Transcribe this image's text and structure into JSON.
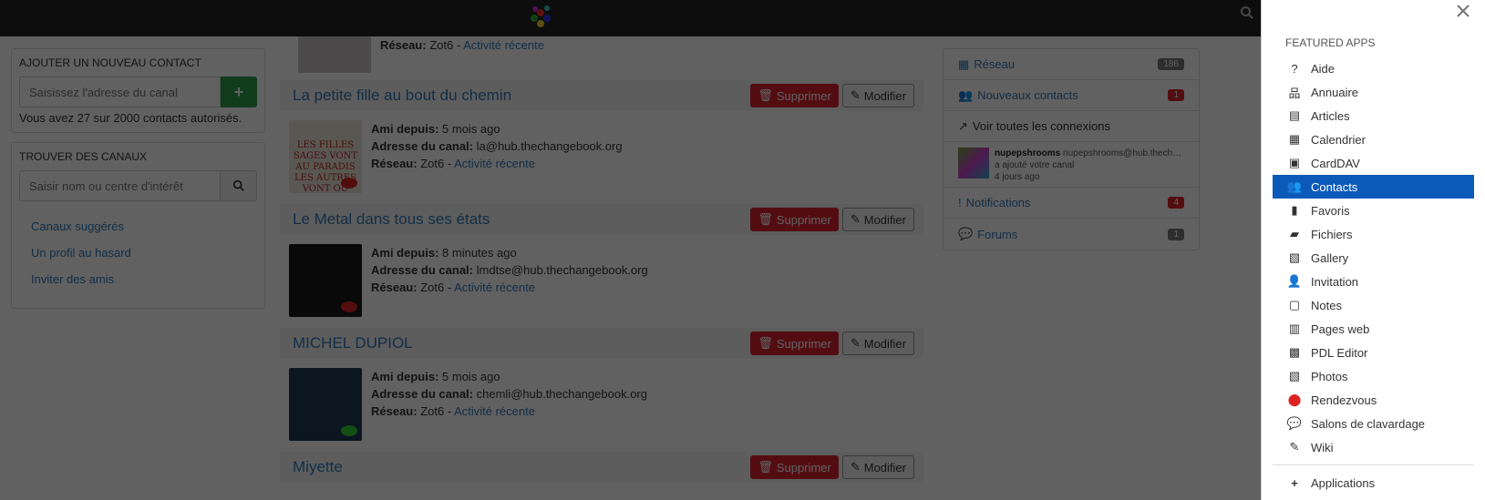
{
  "left": {
    "add_contact": {
      "title": "AJOUTER UN NOUVEAU CONTACT",
      "placeholder": "Saisissez l'adresse du canal",
      "button": "+",
      "hint": "Vous avez 27 sur 2000 contacts autorisés."
    },
    "find_channels": {
      "title": "TROUVER DES CANAUX",
      "placeholder": "Saisir nom ou centre d'intérêt"
    },
    "links": [
      "Canaux suggérés",
      "Un profil au hasard",
      "Inviter des amis"
    ]
  },
  "main": {
    "top_fragment": {
      "network_label": "Réseau:",
      "network_value": "Zot6 -",
      "network_link": "Activité récente"
    },
    "contacts": [
      {
        "name": "La petite fille au bout du chemin",
        "since_label": "Ami depuis:",
        "since": "5 mois ago",
        "addr_label": "Adresse du canal:",
        "addr": "la@hub.thechangebook.org",
        "net_label": "Réseau:",
        "net": "Zot6 -",
        "net_link": "Activité récente"
      },
      {
        "name": "Le Metal dans tous ses états",
        "since_label": "Ami depuis:",
        "since": "8 minutes ago",
        "addr_label": "Adresse du canal:",
        "addr": "lmdtse@hub.thechangebook.org",
        "net_label": "Réseau:",
        "net": "Zot6 -",
        "net_link": "Activité récente"
      },
      {
        "name": "MICHEL DUPIOL",
        "since_label": "Ami depuis:",
        "since": "5 mois ago",
        "addr_label": "Adresse du canal:",
        "addr": "chemli@hub.thechangebook.org",
        "net_label": "Réseau:",
        "net": "Zot6 -",
        "net_link": "Activité récente"
      },
      {
        "name": "Miyette"
      }
    ],
    "delete_label": "Supprimer",
    "edit_label": "Modifier",
    "photo_caption": "LES FILLES SAGES VONT AU PARADIS LES AUTRES VONT OÙ ELLES VEULENT"
  },
  "right": {
    "network": {
      "label": "Réseau",
      "count": "186"
    },
    "new_contacts": {
      "label": "Nouveaux contacts",
      "count": "1"
    },
    "all_connections": "Voir toutes les connexions",
    "notice": {
      "name": "nupepshrooms",
      "addr": "nupepshrooms@hub.thech…",
      "text": "a ajouté votre canal",
      "time": "4 jours ago"
    },
    "notifications": {
      "label": "Notifications",
      "count": "4"
    },
    "forums": {
      "label": "Forums",
      "count": "1"
    }
  },
  "drawer": {
    "featured_title": "FEATURED APPS",
    "apps": [
      "Aide",
      "Annuaire",
      "Articles",
      "Calendrier",
      "CardDAV",
      "Contacts",
      "Favoris",
      "Fichiers",
      "Gallery",
      "Invitation",
      "Notes",
      "Pages web",
      "PDL Editor",
      "Photos",
      "Rendezvous",
      "Salons de clavardage",
      "Wiki"
    ],
    "bottom_app": "Applications"
  },
  "colors": {
    "accent": "#337ab7",
    "danger": "#d9232e",
    "active": "#0b5ab9",
    "success": "#2e9e4a"
  }
}
